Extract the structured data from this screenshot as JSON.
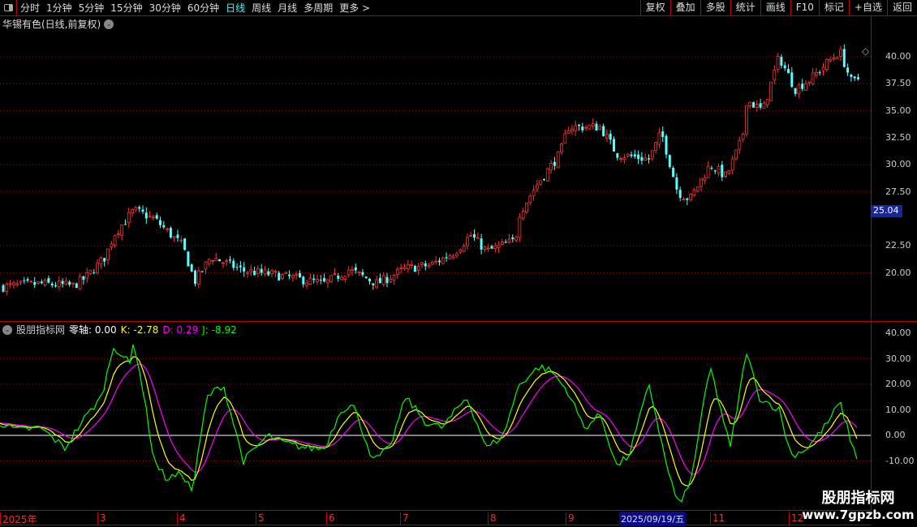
{
  "toolbar": {
    "periods": [
      "分时",
      "1分钟",
      "5分钟",
      "15分钟",
      "30分钟",
      "60分钟",
      "日线",
      "周线",
      "月线",
      "多周期",
      "更多 >"
    ],
    "active": "日线",
    "buttons": [
      "复权",
      "叠加",
      "多股",
      "统计",
      "画线",
      "F10",
      "标记",
      "+自选",
      "返回"
    ]
  },
  "title": "华锡有色(日线,前复权)",
  "price_axis": {
    "ticks": [
      "40.00",
      "37.50",
      "35.00",
      "32.50",
      "30.00",
      "27.50",
      "22.50",
      "20.00"
    ],
    "current": "25.04"
  },
  "indicator": {
    "name": "股朋指标网",
    "zero_label": "零轴:",
    "zero": "0.00",
    "k_label": "K:",
    "k": "-2.78",
    "d_label": "D:",
    "d": "0.29",
    "j_label": "J:",
    "j": "-8.92",
    "ticks": [
      "40.00",
      "30.00",
      "20.00",
      "10.00",
      "0.00",
      "-10.00"
    ]
  },
  "colors": {
    "up": "#ff3232",
    "down": "#54ffff",
    "k": "#ffff00",
    "d": "#ff00ff",
    "j": "#00ff00",
    "zero": "#ffffff"
  },
  "xaxis": {
    "labels": [
      "2025年",
      "3",
      "4",
      "5",
      "6",
      "7",
      "8",
      "9",
      "11",
      "12"
    ],
    "selected": "2025/09/19/五"
  },
  "watermark": {
    "name": "股朋指标网",
    "url": "www.7gpzb.com"
  },
  "chart_data": {
    "type": "candlestick",
    "price_path": [
      [
        0,
        18.7
      ],
      [
        50,
        19.0
      ],
      [
        90,
        18.8
      ],
      [
        105,
        19.5
      ],
      [
        130,
        21.5
      ],
      [
        140,
        23.5
      ],
      [
        165,
        25.8
      ],
      [
        190,
        25
      ],
      [
        225,
        22.5
      ],
      [
        240,
        19.2
      ],
      [
        260,
        21.5
      ],
      [
        300,
        20.2
      ],
      [
        340,
        19.8
      ],
      [
        400,
        19.0
      ],
      [
        430,
        20.3
      ],
      [
        465,
        19.0
      ],
      [
        500,
        20.4
      ],
      [
        530,
        20.7
      ],
      [
        560,
        21.9
      ],
      [
        580,
        23.5
      ],
      [
        600,
        22.0
      ],
      [
        635,
        23.0
      ],
      [
        640,
        25.5
      ],
      [
        660,
        28.0
      ],
      [
        690,
        31
      ],
      [
        700,
        33.5
      ],
      [
        740,
        33.5
      ],
      [
        760,
        31.0
      ],
      [
        800,
        30.5
      ],
      [
        815,
        33
      ],
      [
        835,
        27.5
      ],
      [
        850,
        26.8
      ],
      [
        875,
        30
      ],
      [
        895,
        28.9
      ],
      [
        915,
        32.5
      ],
      [
        920,
        36
      ],
      [
        940,
        35
      ],
      [
        960,
        40
      ],
      [
        980,
        37
      ],
      [
        1000,
        38
      ],
      [
        1020,
        39.5
      ],
      [
        1035,
        40.5
      ],
      [
        1050,
        37.5
      ],
      [
        1058,
        38
      ]
    ],
    "j_path": [
      [
        0,
        5
      ],
      [
        20,
        2
      ],
      [
        50,
        3
      ],
      [
        80,
        -5
      ],
      [
        100,
        5
      ],
      [
        125,
        15
      ],
      [
        140,
        35
      ],
      [
        160,
        28
      ],
      [
        165,
        37
      ],
      [
        175,
        20
      ],
      [
        190,
        -10
      ],
      [
        205,
        -17
      ],
      [
        225,
        -15
      ],
      [
        237,
        -22
      ],
      [
        255,
        15
      ],
      [
        275,
        20
      ],
      [
        300,
        -10
      ],
      [
        330,
        0
      ],
      [
        350,
        -3
      ],
      [
        380,
        -5
      ],
      [
        400,
        -5
      ],
      [
        420,
        10
      ],
      [
        435,
        12
      ],
      [
        460,
        -10
      ],
      [
        480,
        -5
      ],
      [
        500,
        15
      ],
      [
        525,
        5
      ],
      [
        545,
        3
      ],
      [
        575,
        15
      ],
      [
        600,
        -5
      ],
      [
        620,
        0
      ],
      [
        640,
        20
      ],
      [
        665,
        27
      ],
      [
        680,
        25
      ],
      [
        700,
        17
      ],
      [
        720,
        3
      ],
      [
        740,
        8
      ],
      [
        760,
        -12
      ],
      [
        775,
        -8
      ],
      [
        800,
        20
      ],
      [
        820,
        -10
      ],
      [
        835,
        -27
      ],
      [
        850,
        -20
      ],
      [
        875,
        27
      ],
      [
        900,
        -5
      ],
      [
        920,
        33
      ],
      [
        935,
        15
      ],
      [
        960,
        10
      ],
      [
        975,
        -8
      ],
      [
        995,
        -5
      ],
      [
        1020,
        5
      ],
      [
        1035,
        13
      ],
      [
        1055,
        -9
      ]
    ]
  }
}
